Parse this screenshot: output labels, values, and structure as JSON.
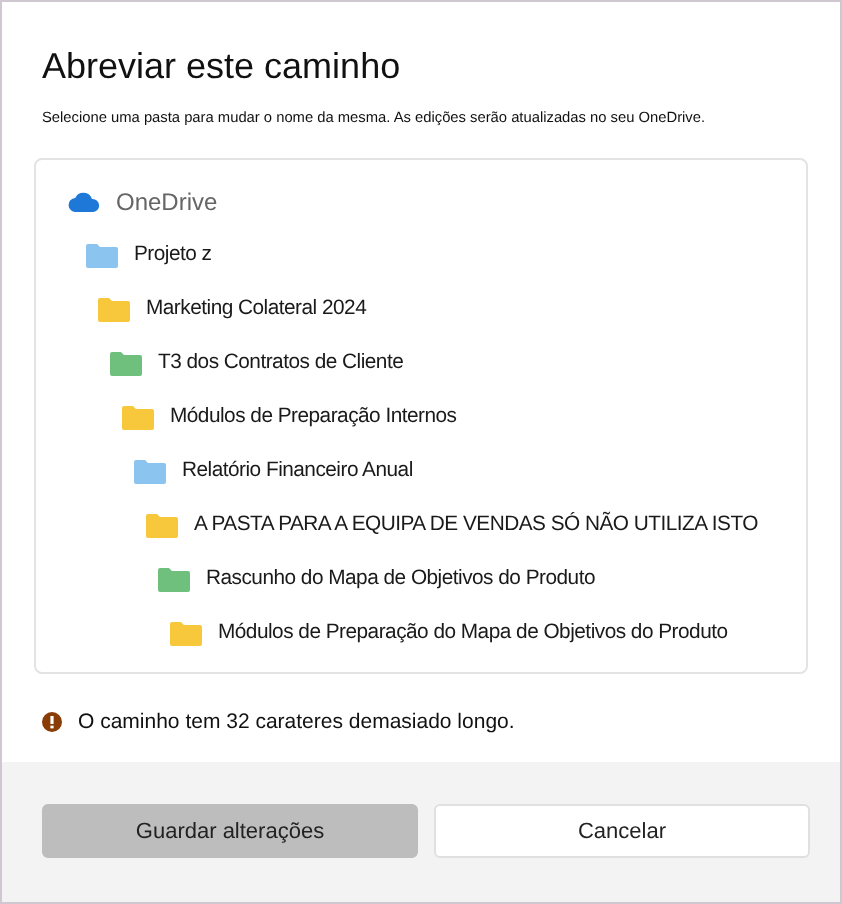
{
  "dialog": {
    "title": "Abreviar este caminho",
    "subtitle": "Selecione uma pasta para mudar o nome da mesma. As edições serão atualizadas no seu OneDrive."
  },
  "tree": [
    {
      "kind": "cloud",
      "label": "OneDrive",
      "children": [
        {
          "kind": "folder",
          "label": "Projeto z",
          "color": "#8cc4f0",
          "children": [
            {
              "kind": "folder",
              "label": "Marketing Colateral 2024",
              "color": "#f8c83c",
              "children": [
                {
                  "kind": "folder",
                  "label": "T3 dos Contratos de Cliente",
                  "color": "#6fbf7d",
                  "children": [
                    {
                      "kind": "folder",
                      "label": "Módulos de Preparação Internos",
                      "color": "#f8c83c",
                      "children": [
                        {
                          "kind": "folder",
                          "label": "Relatório Financeiro Anual",
                          "color": "#8cc4f0",
                          "children": [
                            {
                              "kind": "folder",
                              "label": "A PASTA PARA A EQUIPA DE VENDAS SÓ NÃO UTILIZA ISTO",
                              "color": "#f8c83c",
                              "children": [
                                {
                                  "kind": "folder",
                                  "label": "Rascunho do Mapa de Objetivos do Produto",
                                  "color": "#6fbf7d",
                                  "children": [
                                    {
                                      "kind": "folder",
                                      "label": "Módulos de Preparação do Mapa de Objetivos do Produto",
                                      "color": "#f8c83c"
                                    }
                                  ]
                                }
                              ]
                            }
                          ]
                        }
                      ]
                    }
                  ]
                }
              ]
            }
          ]
        }
      ]
    }
  ],
  "warning": "O caminho tem 32 carateres demasiado longo.",
  "buttons": [
    {
      "kind": "primary",
      "label": "Guardar alterações",
      "disabled": true
    },
    {
      "kind": "secondary",
      "label": "Cancelar",
      "disabled": false
    }
  ]
}
